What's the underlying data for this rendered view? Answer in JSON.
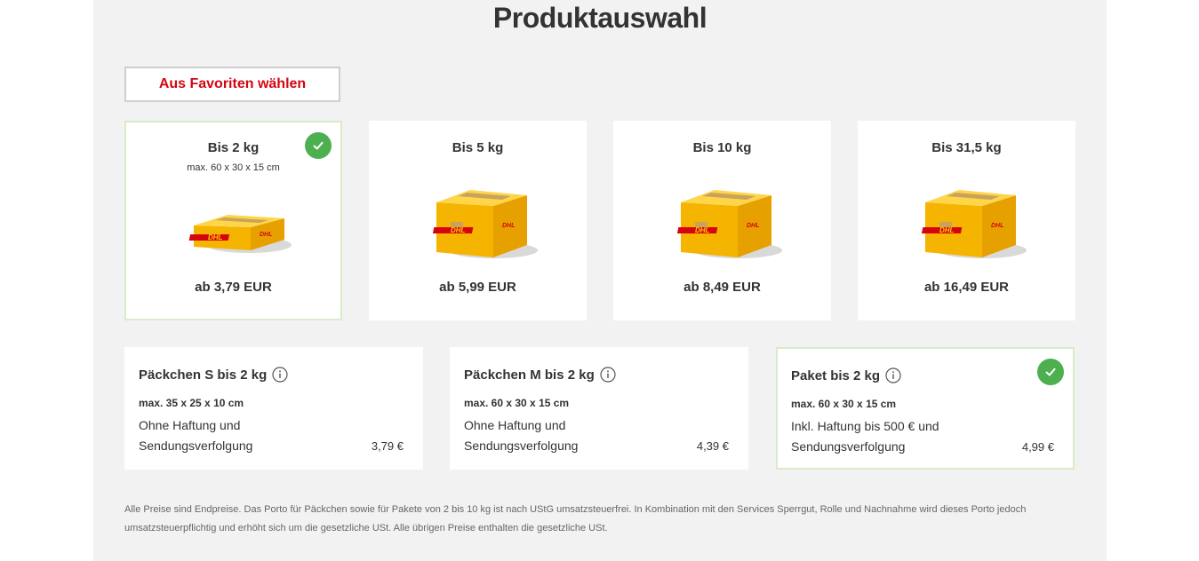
{
  "page": {
    "title": "Produktauswahl"
  },
  "favorites_button": {
    "label": "Aus Favoriten wählen"
  },
  "weight_cards": [
    {
      "title": "Bis 2 kg",
      "dims": "max. 60 x 30 x 15 cm",
      "price": "ab 3,79 EUR",
      "selected": true
    },
    {
      "title": "Bis 5 kg",
      "dims": "",
      "price": "ab 5,99 EUR",
      "selected": false
    },
    {
      "title": "Bis 10 kg",
      "dims": "",
      "price": "ab 8,49 EUR",
      "selected": false
    },
    {
      "title": "Bis 31,5 kg",
      "dims": "",
      "price": "ab 16,49 EUR",
      "selected": false
    }
  ],
  "products": [
    {
      "title": "Päckchen S bis 2 kg",
      "dims": "max. 35 x 25 x 10 cm",
      "desc_line1": "Ohne Haftung und",
      "desc_line2": "Sendungsverfolgung",
      "price": "3,79 €",
      "selected": false
    },
    {
      "title": "Päckchen M bis 2 kg",
      "dims": "max. 60 x 30 x 15 cm",
      "desc_line1": "Ohne Haftung und",
      "desc_line2": "Sendungsverfolgung",
      "price": "4,39 €",
      "selected": false
    },
    {
      "title": "Paket bis 2 kg",
      "dims": "max. 60 x 30 x 15 cm",
      "desc_line1": "Inkl. Haftung bis 500 € und",
      "desc_line2": "Sendungsverfolgung",
      "price": "4,99 €",
      "selected": true
    }
  ],
  "footnote": "Alle Preise sind Endpreise. Das Porto für Päckchen sowie für Pakete von 2 bis 10 kg ist nach UStG umsatzsteuerfrei. In Kombination mit den Services Sperrgut, Rolle und Nachnahme wird dieses Porto jedoch umsatzsteuerpflichtig und erhöht sich um die gesetzliche USt. Alle übrigen Preise enthalten die gesetzliche USt.",
  "colors": {
    "accent_red": "#d40511",
    "dhl_yellow": "#ffcc00",
    "check_green": "#4caf50",
    "selected_border": "#d8ecc8",
    "panel_bg": "#f2f2f2"
  },
  "icons": {
    "selected": "check-circle-icon",
    "info": "info-icon",
    "product_image": "dhl-package-icon"
  }
}
